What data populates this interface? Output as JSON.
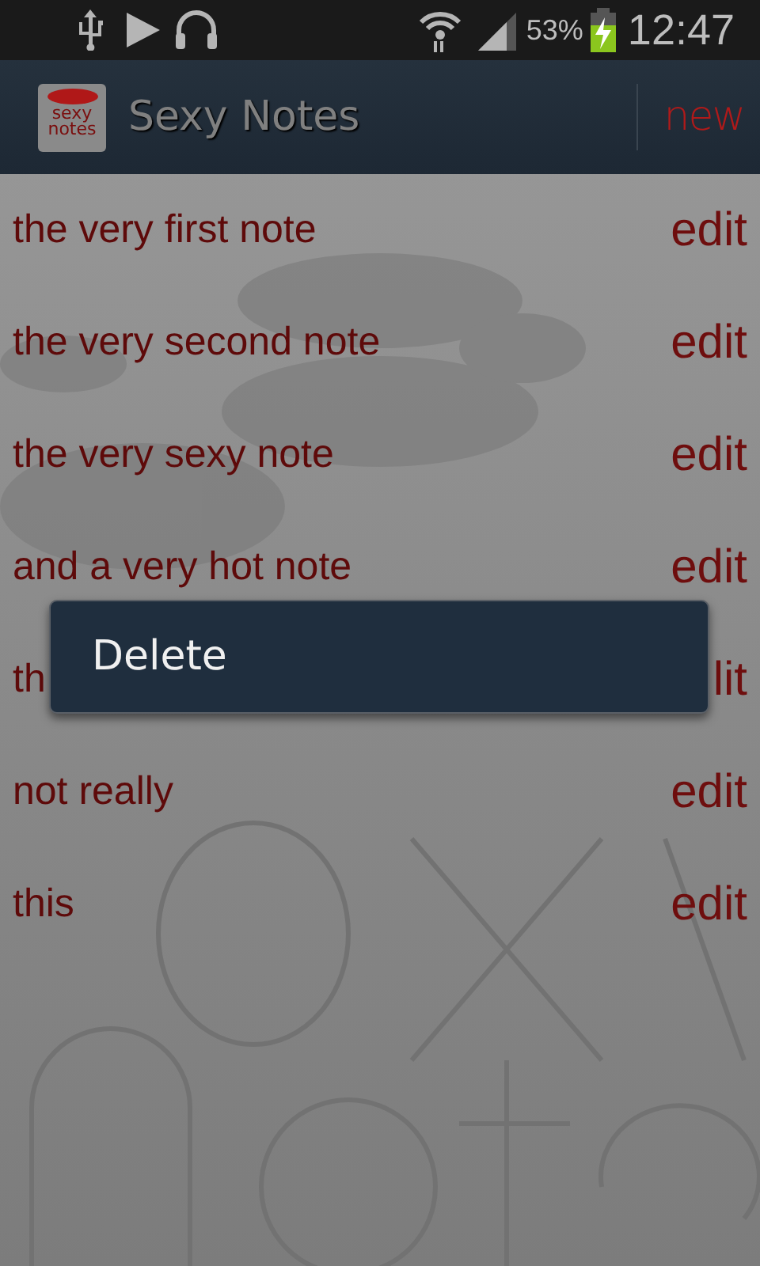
{
  "status_bar": {
    "battery_percent": "53%",
    "time": "12:47"
  },
  "action_bar": {
    "title": "Sexy Notes",
    "app_icon_text": [
      "sexy",
      "notes"
    ],
    "action": "new"
  },
  "notes": [
    {
      "text": "the very first note",
      "action": "edit"
    },
    {
      "text": "the very second note",
      "action": "edit"
    },
    {
      "text": "the very sexy note",
      "action": "edit"
    },
    {
      "text": "and a very hot note",
      "action": "edit"
    },
    {
      "text": "th",
      "action": "lit"
    },
    {
      "text": "not really",
      "action": "edit"
    },
    {
      "text": "this",
      "action": "edit"
    }
  ],
  "context_menu": {
    "items": [
      "Delete"
    ]
  }
}
